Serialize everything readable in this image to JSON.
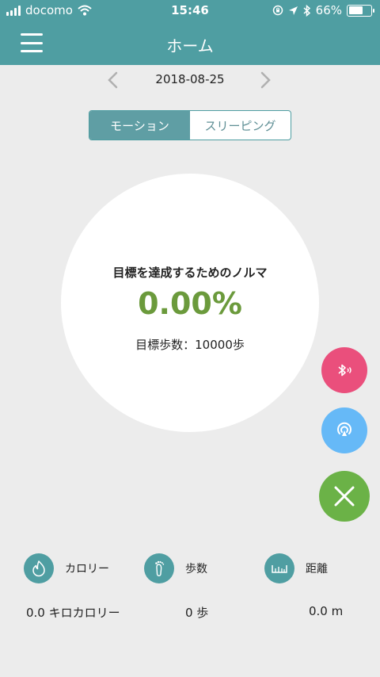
{
  "status": {
    "carrier": "docomo",
    "time": "15:46",
    "battery": "66%",
    "battery_level": 0.66
  },
  "header": {
    "title": "ホーム"
  },
  "date": "2018-08-25",
  "tabs": [
    "モーション",
    "スリーピング"
  ],
  "goal": {
    "label": "目標を達成するためのノルマ",
    "percent": "0.00%",
    "steps": "目標歩数：10000歩"
  },
  "stats": {
    "calorie_label": "カロリー",
    "steps_label": "歩数",
    "distance_label": "距離",
    "calorie_value": "0.0 キロカロリー",
    "steps_value": "0 歩",
    "distance_value": "0.0 m"
  }
}
